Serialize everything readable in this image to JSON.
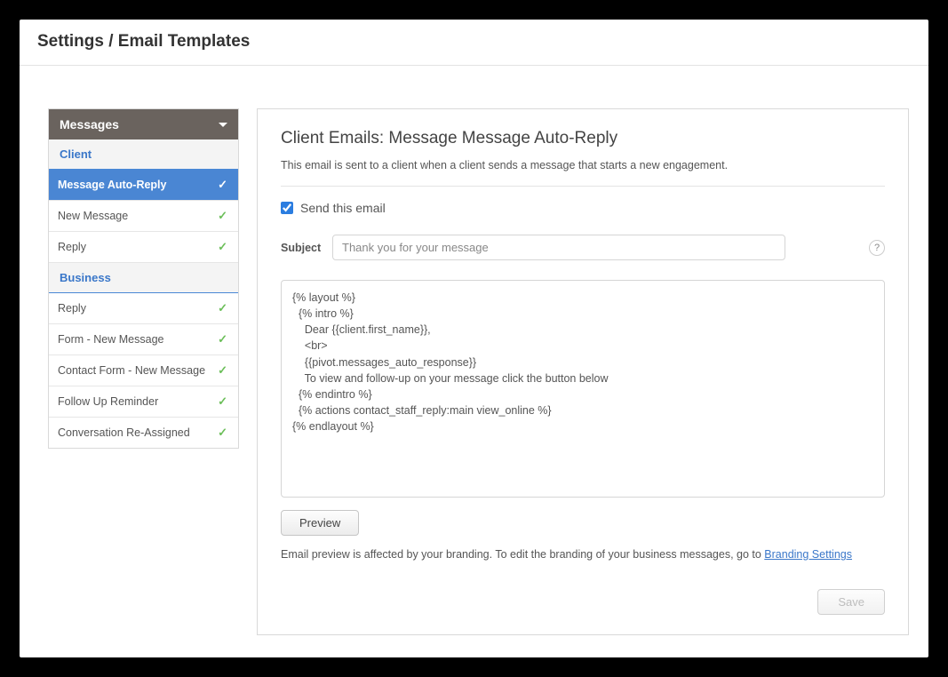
{
  "header": {
    "title": "Settings / Email Templates"
  },
  "sidebar": {
    "heading": "Messages",
    "sections": [
      {
        "label": "Client",
        "items": [
          {
            "label": "Message Auto-Reply",
            "active": true
          },
          {
            "label": "New Message"
          },
          {
            "label": "Reply"
          }
        ]
      },
      {
        "label": "Business",
        "items": [
          {
            "label": "Reply"
          },
          {
            "label": "Form - New Message"
          },
          {
            "label": "Contact Form - New Message"
          },
          {
            "label": "Follow Up Reminder"
          },
          {
            "label": "Conversation Re-Assigned"
          }
        ]
      }
    ]
  },
  "panel": {
    "title": "Client Emails: Message Message Auto-Reply",
    "description": "This email is sent to a client when a client sends a message that starts a new engagement.",
    "send_checkbox_label": "Send this email",
    "send_checked": true,
    "subject_label": "Subject",
    "subject_value": "Thank you for your message",
    "body_value": "{% layout %}\n  {% intro %}\n    Dear {{client.first_name}},\n    <br>\n    {{pivot.messages_auto_response}}\n    To view and follow-up on your message click the button below\n  {% endintro %}\n  {% actions contact_staff_reply:main view_online %}\n{% endlayout %}",
    "preview_label": "Preview",
    "footer_note_prefix": "Email preview is affected by your branding. To edit the branding of your business messages, go to ",
    "footer_link": "Branding Settings",
    "save_label": "Save",
    "help_label": "?"
  }
}
